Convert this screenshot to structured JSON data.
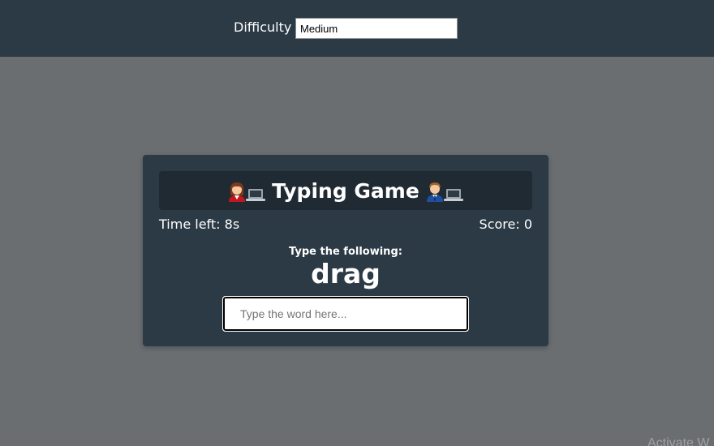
{
  "header": {
    "difficulty_label": "Difficulty",
    "difficulty_selected": "Medium"
  },
  "game": {
    "title": "Typing Game",
    "title_icons": [
      "woman-technologist-icon",
      "laptop-icon",
      "man-technologist-icon",
      "laptop-icon"
    ],
    "time_left_text": "Time left: 8s",
    "score_text": "Score: 0",
    "instruction": "Type the following:",
    "word": "drag",
    "input_value": "",
    "input_placeholder": "Type the word here..."
  },
  "watermark": "Activate W",
  "colors": {
    "page_bg": "#6a6e71",
    "header_bg": "#2b3a45",
    "card_bg": "#2b3a45",
    "title_bar_bg": "#202a33",
    "text": "#ffffff"
  }
}
